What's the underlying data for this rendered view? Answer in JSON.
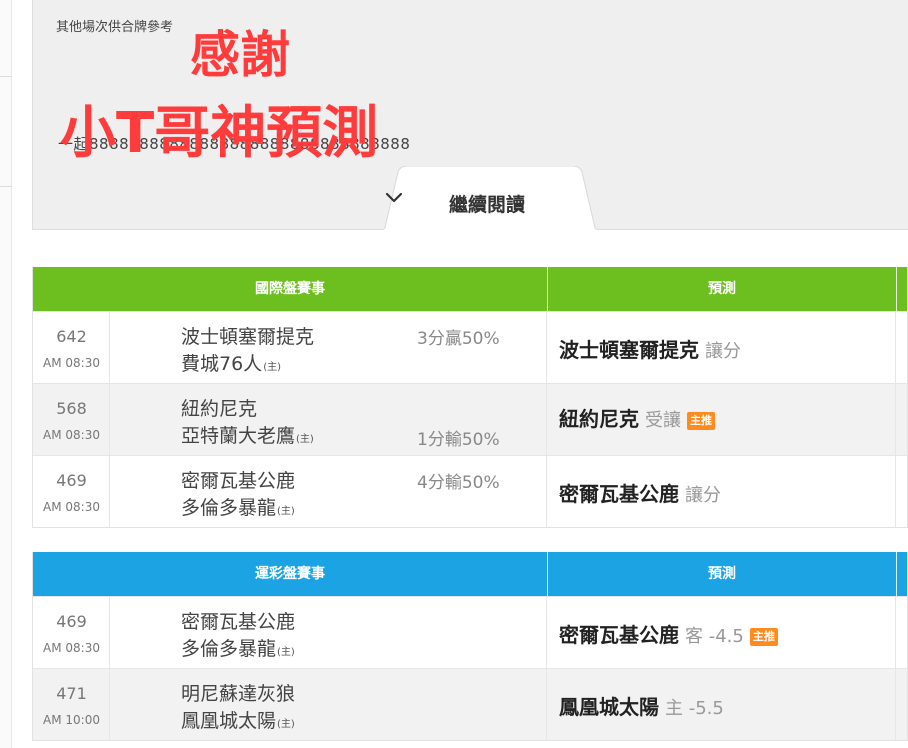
{
  "reference": {
    "title": "其他場次供合牌參考",
    "hidden_line": "一起88888888888888888888888888888888",
    "overlay_line1": "感謝",
    "overlay_line2": "小T哥神預測",
    "read_more_label": "繼續閱讀"
  },
  "colors": {
    "international_header": "#6cbf1e",
    "lottery_header": "#1ba3e3",
    "overlay_text": "#ff3b3b",
    "badge": "#ff8a1e"
  },
  "international": {
    "header": {
      "title": "國際盤賽事",
      "prediction": "預測"
    },
    "rows": [
      {
        "id": "642",
        "time": "AM 08:30",
        "team_away": "波士頓塞爾提克",
        "team_home": "費城76人",
        "home_tag": "(主)",
        "result_top": "3分贏50%",
        "result_bottom": "",
        "pred_team": "波士頓塞爾提克",
        "pred_pick": "讓分",
        "badge": ""
      },
      {
        "id": "568",
        "time": "AM 08:30",
        "team_away": "紐約尼克",
        "team_home": "亞特蘭大老鷹",
        "home_tag": "(主)",
        "result_top": "",
        "result_bottom": "1分輸50%",
        "pred_team": "紐約尼克",
        "pred_pick": "受讓",
        "badge": "主推"
      },
      {
        "id": "469",
        "time": "AM 08:30",
        "team_away": "密爾瓦基公鹿",
        "team_home": "多倫多暴龍",
        "home_tag": "(主)",
        "result_top": "4分輸50%",
        "result_bottom": "",
        "pred_team": "密爾瓦基公鹿",
        "pred_pick": "讓分",
        "badge": ""
      }
    ]
  },
  "lottery": {
    "header": {
      "title": "運彩盤賽事",
      "prediction": "預測"
    },
    "rows": [
      {
        "id": "469",
        "time": "AM 08:30",
        "team_away": "密爾瓦基公鹿",
        "team_home": "多倫多暴龍",
        "home_tag": "(主)",
        "pred_team": "密爾瓦基公鹿",
        "pred_pick": "客 -4.5",
        "badge": "主推"
      },
      {
        "id": "471",
        "time": "AM 10:00",
        "team_away": "明尼蘇達灰狼",
        "team_home": "鳳凰城太陽",
        "home_tag": "(主)",
        "pred_team": "鳳凰城太陽",
        "pred_pick": "主 -5.5",
        "badge": ""
      }
    ]
  }
}
